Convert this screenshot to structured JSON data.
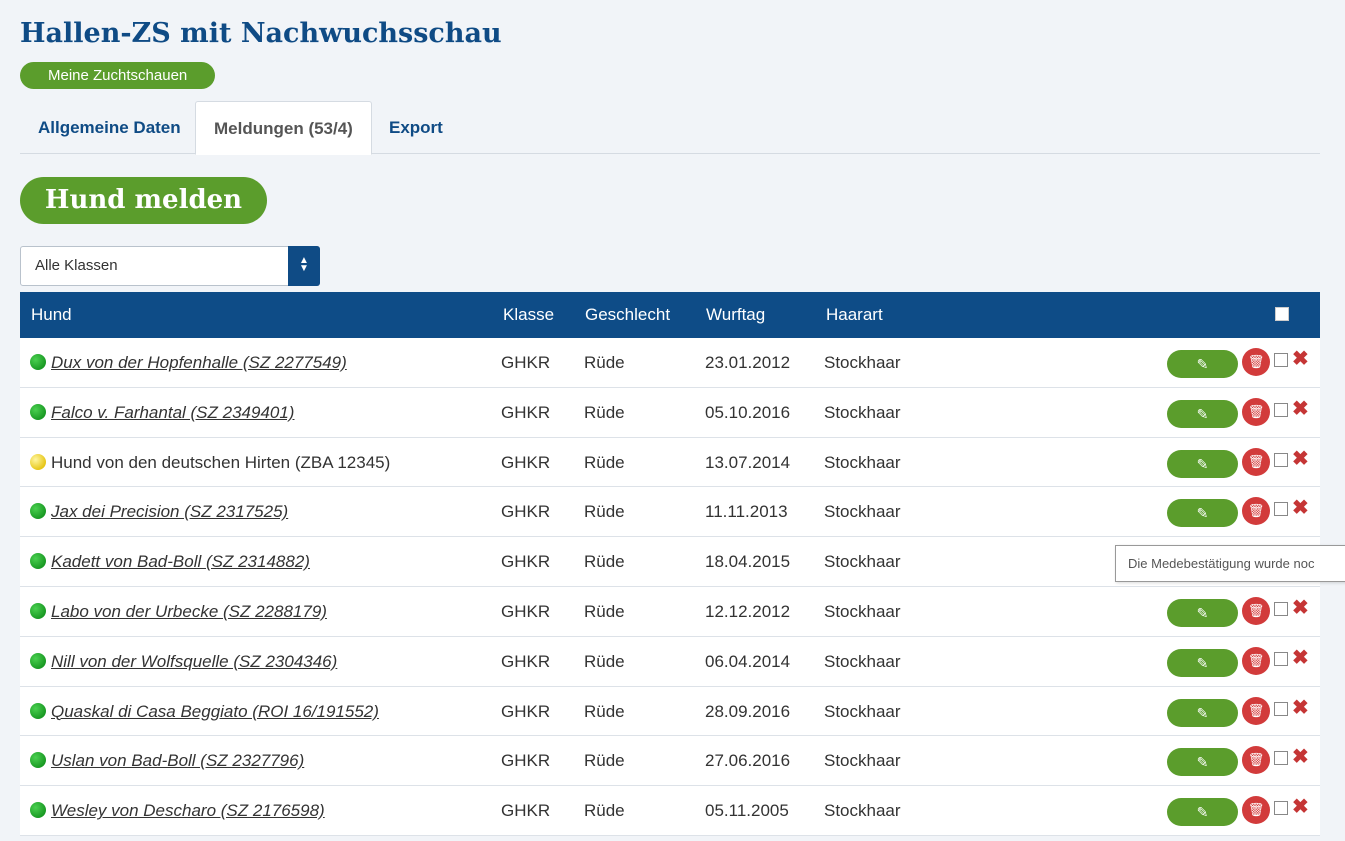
{
  "page_title": "Hallen-ZS mit Nachwuchsschau",
  "my_shows_button": "Meine Zuchtschauen",
  "tabs": [
    {
      "label": "Allgemeine Daten"
    },
    {
      "label": "Meldungen (53/4)"
    },
    {
      "label": "Export"
    }
  ],
  "register_button": "Hund melden",
  "class_filter": {
    "selected": "Alle Klassen"
  },
  "table": {
    "headers": {
      "hund": "Hund",
      "klasse": "Klasse",
      "geschlecht": "Geschlecht",
      "wurftag": "Wurftag",
      "haarart": "Haarart"
    },
    "rows": [
      {
        "hund": "Dux von der Hopfenhalle (SZ 2277549)",
        "klasse": "GHKR",
        "geschlecht": "Rüde",
        "wurftag": "23.01.2012",
        "haarart": "Stockhaar",
        "status": "green"
      },
      {
        "hund": "Falco v. Farhantal (SZ 2349401)",
        "klasse": "GHKR",
        "geschlecht": "Rüde",
        "wurftag": "05.10.2016",
        "haarart": "Stockhaar",
        "status": "green"
      },
      {
        "hund": "Hund von den deutschen Hirten (ZBA 12345)",
        "klasse": "GHKR",
        "geschlecht": "Rüde",
        "wurftag": "13.07.2014",
        "haarart": "Stockhaar",
        "status": "yellow"
      },
      {
        "hund": "Jax dei Precision (SZ 2317525)",
        "klasse": "GHKR",
        "geschlecht": "Rüde",
        "wurftag": "11.11.2013",
        "haarart": "Stockhaar",
        "status": "green"
      },
      {
        "hund": "Kadett von Bad-Boll (SZ 2314882)",
        "klasse": "GHKR",
        "geschlecht": "Rüde",
        "wurftag": "18.04.2015",
        "haarart": "Stockhaar",
        "status": "green"
      },
      {
        "hund": "Labo von der Urbecke (SZ 2288179)",
        "klasse": "GHKR",
        "geschlecht": "Rüde",
        "wurftag": "12.12.2012",
        "haarart": "Stockhaar",
        "status": "green"
      },
      {
        "hund": "Nill von der Wolfsquelle (SZ 2304346)",
        "klasse": "GHKR",
        "geschlecht": "Rüde",
        "wurftag": "06.04.2014",
        "haarart": "Stockhaar",
        "status": "green"
      },
      {
        "hund": "Quaskal di Casa Beggiato (ROI 16/191552)",
        "klasse": "GHKR",
        "geschlecht": "Rüde",
        "wurftag": "28.09.2016",
        "haarart": "Stockhaar",
        "status": "green"
      },
      {
        "hund": "Uslan von Bad-Boll (SZ 2327796)",
        "klasse": "GHKR",
        "geschlecht": "Rüde",
        "wurftag": "27.06.2016",
        "haarart": "Stockhaar",
        "status": "green"
      },
      {
        "hund": "Wesley von Descharo (SZ 2176598)",
        "klasse": "GHKR",
        "geschlecht": "Rüde",
        "wurftag": "05.11.2005",
        "haarart": "Stockhaar",
        "status": "green"
      }
    ]
  },
  "tooltip": "Die Medebestätigung wurde noc",
  "colors": {
    "brand_blue": "#0f4b85",
    "brand_green": "#5b9d2c",
    "delete_red": "#d23b3b"
  },
  "icons": {
    "edit": "pencil-icon",
    "delete": "trash-icon",
    "remove": "x-icon",
    "status": "status-dot-icon"
  }
}
